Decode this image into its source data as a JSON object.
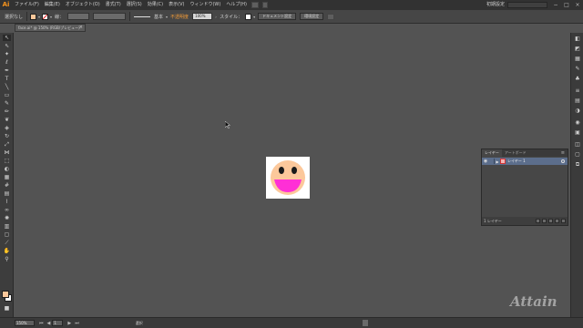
{
  "app": {
    "logo": "Ai"
  },
  "menubar": {
    "items": [
      "ファイル(F)",
      "編集(E)",
      "オブジェクト(O)",
      "書式(T)",
      "選択(S)",
      "効果(C)",
      "表示(V)",
      "ウィンドウ(W)",
      "ヘルプ(H)"
    ],
    "workspace": "初期設定",
    "search_placeholder": "",
    "window_buttons": [
      "−",
      "□",
      "×"
    ]
  },
  "controlbar": {
    "selection_label": "選択なし",
    "fill_color": "#fcc89b",
    "stroke_label": "線：",
    "stroke_style": "基本",
    "opacity_label": "不透明度",
    "opacity_value": "100%",
    "style_label": "スタイル：",
    "doc_setup_button": "ドキュメント設定",
    "prefs_button": "環境設定"
  },
  "document": {
    "tab_label": "face.ai* @ 150% (RGB/プレビュー)",
    "tab_close": "×"
  },
  "artboard": {
    "face_color": "#fcc89b",
    "mouth_color": "#ff2fd6",
    "eye_color": "#1a1a1a"
  },
  "layers_panel": {
    "tabs": [
      "レイヤー",
      "アートボード"
    ],
    "menu_icon": "≡",
    "layer_name": "レイヤー 1",
    "layer_count": "1 レイヤー",
    "layer_color": "#d33333"
  },
  "statusbar": {
    "zoom": "150%",
    "artboard_number": "1",
    "status_text": "選択"
  },
  "watermark": {
    "text": "Attain"
  },
  "colors": {
    "accent": "#f7941d",
    "panel_selection": "#5c6e8c",
    "canvas": "#535353"
  }
}
